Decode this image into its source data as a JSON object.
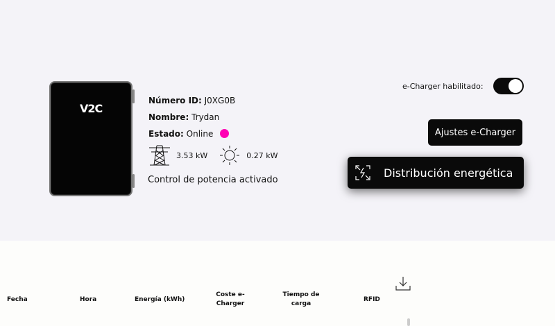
{
  "charger": {
    "logo_text": "V2C"
  },
  "info": {
    "id_label": "Número ID:",
    "id_value": "J0XG0B",
    "name_label": "Nombre:",
    "name_value": "Trydan",
    "status_label": "Estado:",
    "status_value": "Online",
    "status_color": "#ff00b4",
    "grid_power": "3.53 kW",
    "solar_power": "0.27 kW",
    "control_text": "Control de potencia activado"
  },
  "controls": {
    "toggle_label": "e-Charger habilitado:",
    "toggle_on": true,
    "settings_button": "Ajustes e-Charger",
    "distribution_button": "Distribución energética"
  },
  "table": {
    "headers": [
      "Fecha",
      "Hora",
      "Energía (kWh)",
      "Coste e-Charger",
      "Tiempo de carga",
      "RFID"
    ]
  },
  "icons": {
    "grid": "power-tower-icon",
    "solar": "sun-icon",
    "distribution": "energy-distribution-icon",
    "download": "download-icon"
  }
}
